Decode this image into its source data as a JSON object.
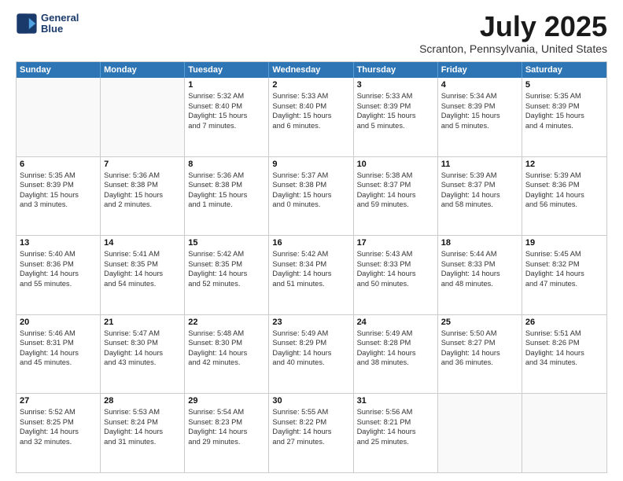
{
  "header": {
    "logo_line1": "General",
    "logo_line2": "Blue",
    "title": "July 2025",
    "subtitle": "Scranton, Pennsylvania, United States"
  },
  "weekdays": [
    "Sunday",
    "Monday",
    "Tuesday",
    "Wednesday",
    "Thursday",
    "Friday",
    "Saturday"
  ],
  "rows": [
    [
      {
        "day": "",
        "lines": [],
        "empty": true
      },
      {
        "day": "",
        "lines": [],
        "empty": true
      },
      {
        "day": "1",
        "lines": [
          "Sunrise: 5:32 AM",
          "Sunset: 8:40 PM",
          "Daylight: 15 hours",
          "and 7 minutes."
        ]
      },
      {
        "day": "2",
        "lines": [
          "Sunrise: 5:33 AM",
          "Sunset: 8:40 PM",
          "Daylight: 15 hours",
          "and 6 minutes."
        ]
      },
      {
        "day": "3",
        "lines": [
          "Sunrise: 5:33 AM",
          "Sunset: 8:39 PM",
          "Daylight: 15 hours",
          "and 5 minutes."
        ]
      },
      {
        "day": "4",
        "lines": [
          "Sunrise: 5:34 AM",
          "Sunset: 8:39 PM",
          "Daylight: 15 hours",
          "and 5 minutes."
        ]
      },
      {
        "day": "5",
        "lines": [
          "Sunrise: 5:35 AM",
          "Sunset: 8:39 PM",
          "Daylight: 15 hours",
          "and 4 minutes."
        ]
      }
    ],
    [
      {
        "day": "6",
        "lines": [
          "Sunrise: 5:35 AM",
          "Sunset: 8:39 PM",
          "Daylight: 15 hours",
          "and 3 minutes."
        ]
      },
      {
        "day": "7",
        "lines": [
          "Sunrise: 5:36 AM",
          "Sunset: 8:38 PM",
          "Daylight: 15 hours",
          "and 2 minutes."
        ]
      },
      {
        "day": "8",
        "lines": [
          "Sunrise: 5:36 AM",
          "Sunset: 8:38 PM",
          "Daylight: 15 hours",
          "and 1 minute."
        ]
      },
      {
        "day": "9",
        "lines": [
          "Sunrise: 5:37 AM",
          "Sunset: 8:38 PM",
          "Daylight: 15 hours",
          "and 0 minutes."
        ]
      },
      {
        "day": "10",
        "lines": [
          "Sunrise: 5:38 AM",
          "Sunset: 8:37 PM",
          "Daylight: 14 hours",
          "and 59 minutes."
        ]
      },
      {
        "day": "11",
        "lines": [
          "Sunrise: 5:39 AM",
          "Sunset: 8:37 PM",
          "Daylight: 14 hours",
          "and 58 minutes."
        ]
      },
      {
        "day": "12",
        "lines": [
          "Sunrise: 5:39 AM",
          "Sunset: 8:36 PM",
          "Daylight: 14 hours",
          "and 56 minutes."
        ]
      }
    ],
    [
      {
        "day": "13",
        "lines": [
          "Sunrise: 5:40 AM",
          "Sunset: 8:36 PM",
          "Daylight: 14 hours",
          "and 55 minutes."
        ]
      },
      {
        "day": "14",
        "lines": [
          "Sunrise: 5:41 AM",
          "Sunset: 8:35 PM",
          "Daylight: 14 hours",
          "and 54 minutes."
        ]
      },
      {
        "day": "15",
        "lines": [
          "Sunrise: 5:42 AM",
          "Sunset: 8:35 PM",
          "Daylight: 14 hours",
          "and 52 minutes."
        ]
      },
      {
        "day": "16",
        "lines": [
          "Sunrise: 5:42 AM",
          "Sunset: 8:34 PM",
          "Daylight: 14 hours",
          "and 51 minutes."
        ]
      },
      {
        "day": "17",
        "lines": [
          "Sunrise: 5:43 AM",
          "Sunset: 8:33 PM",
          "Daylight: 14 hours",
          "and 50 minutes."
        ]
      },
      {
        "day": "18",
        "lines": [
          "Sunrise: 5:44 AM",
          "Sunset: 8:33 PM",
          "Daylight: 14 hours",
          "and 48 minutes."
        ]
      },
      {
        "day": "19",
        "lines": [
          "Sunrise: 5:45 AM",
          "Sunset: 8:32 PM",
          "Daylight: 14 hours",
          "and 47 minutes."
        ]
      }
    ],
    [
      {
        "day": "20",
        "lines": [
          "Sunrise: 5:46 AM",
          "Sunset: 8:31 PM",
          "Daylight: 14 hours",
          "and 45 minutes."
        ]
      },
      {
        "day": "21",
        "lines": [
          "Sunrise: 5:47 AM",
          "Sunset: 8:30 PM",
          "Daylight: 14 hours",
          "and 43 minutes."
        ]
      },
      {
        "day": "22",
        "lines": [
          "Sunrise: 5:48 AM",
          "Sunset: 8:30 PM",
          "Daylight: 14 hours",
          "and 42 minutes."
        ]
      },
      {
        "day": "23",
        "lines": [
          "Sunrise: 5:49 AM",
          "Sunset: 8:29 PM",
          "Daylight: 14 hours",
          "and 40 minutes."
        ]
      },
      {
        "day": "24",
        "lines": [
          "Sunrise: 5:49 AM",
          "Sunset: 8:28 PM",
          "Daylight: 14 hours",
          "and 38 minutes."
        ]
      },
      {
        "day": "25",
        "lines": [
          "Sunrise: 5:50 AM",
          "Sunset: 8:27 PM",
          "Daylight: 14 hours",
          "and 36 minutes."
        ]
      },
      {
        "day": "26",
        "lines": [
          "Sunrise: 5:51 AM",
          "Sunset: 8:26 PM",
          "Daylight: 14 hours",
          "and 34 minutes."
        ]
      }
    ],
    [
      {
        "day": "27",
        "lines": [
          "Sunrise: 5:52 AM",
          "Sunset: 8:25 PM",
          "Daylight: 14 hours",
          "and 32 minutes."
        ]
      },
      {
        "day": "28",
        "lines": [
          "Sunrise: 5:53 AM",
          "Sunset: 8:24 PM",
          "Daylight: 14 hours",
          "and 31 minutes."
        ]
      },
      {
        "day": "29",
        "lines": [
          "Sunrise: 5:54 AM",
          "Sunset: 8:23 PM",
          "Daylight: 14 hours",
          "and 29 minutes."
        ]
      },
      {
        "day": "30",
        "lines": [
          "Sunrise: 5:55 AM",
          "Sunset: 8:22 PM",
          "Daylight: 14 hours",
          "and 27 minutes."
        ]
      },
      {
        "day": "31",
        "lines": [
          "Sunrise: 5:56 AM",
          "Sunset: 8:21 PM",
          "Daylight: 14 hours",
          "and 25 minutes."
        ]
      },
      {
        "day": "",
        "lines": [],
        "empty": true
      },
      {
        "day": "",
        "lines": [],
        "empty": true
      }
    ]
  ]
}
